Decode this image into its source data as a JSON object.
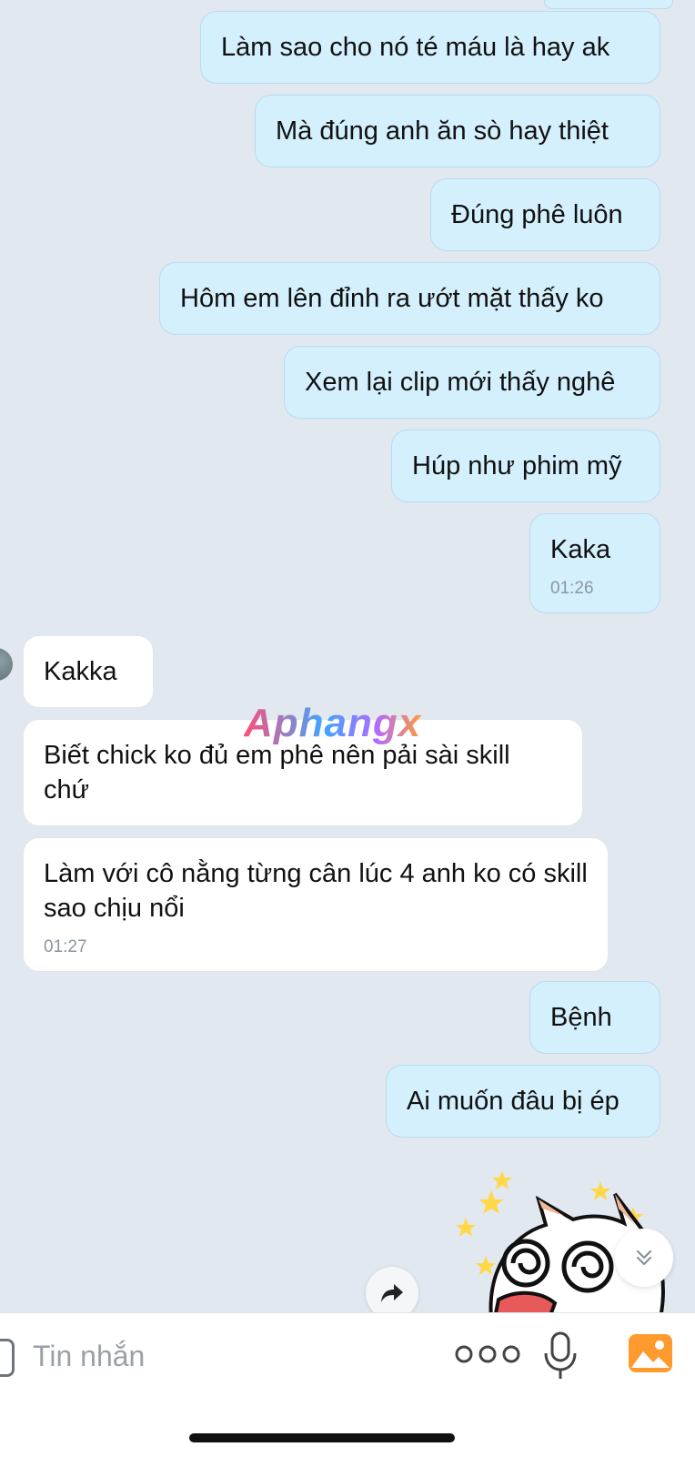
{
  "messages": [
    {
      "dir": "out",
      "text": "Làm sao cho nó té máu là hay ak"
    },
    {
      "dir": "out",
      "text": "Mà đúng anh ăn sò hay thiệt"
    },
    {
      "dir": "out",
      "text": "Đúng phê luôn"
    },
    {
      "dir": "out",
      "text": "Hôm em lên đỉnh ra ướt mặt thấy ko"
    },
    {
      "dir": "out",
      "text": "Xem lại clip mới thấy nghê"
    },
    {
      "dir": "out",
      "text": "Húp như phim mỹ"
    },
    {
      "dir": "out",
      "text": "Kaka",
      "time": "01:26"
    },
    {
      "dir": "in",
      "text": "Kakka"
    },
    {
      "dir": "in",
      "text": "Biết chick ko đủ em phê nên pải sài skill chứ"
    },
    {
      "dir": "in",
      "text": "Làm với cô nằng từng cân lúc 4 anh ko có skill sao chịu nổi",
      "time": "01:27"
    },
    {
      "dir": "out",
      "text": "Bệnh"
    },
    {
      "dir": "out",
      "text": "Ai muốn đâu bị ép"
    }
  ],
  "watermark": "Aphangx",
  "composer": {
    "placeholder": "Tin nhắn"
  },
  "icons": {
    "more": "more-dots-icon",
    "mic": "microphone-icon",
    "gallery": "gallery-icon",
    "scroll": "chevron-double-down-icon",
    "forward": "forward-arrow-icon"
  },
  "colors": {
    "background": "#e2e8ef",
    "outgoing_bubble": "#d4f0fd",
    "incoming_bubble": "#ffffff",
    "gallery_icon": "#ff9a2e"
  }
}
